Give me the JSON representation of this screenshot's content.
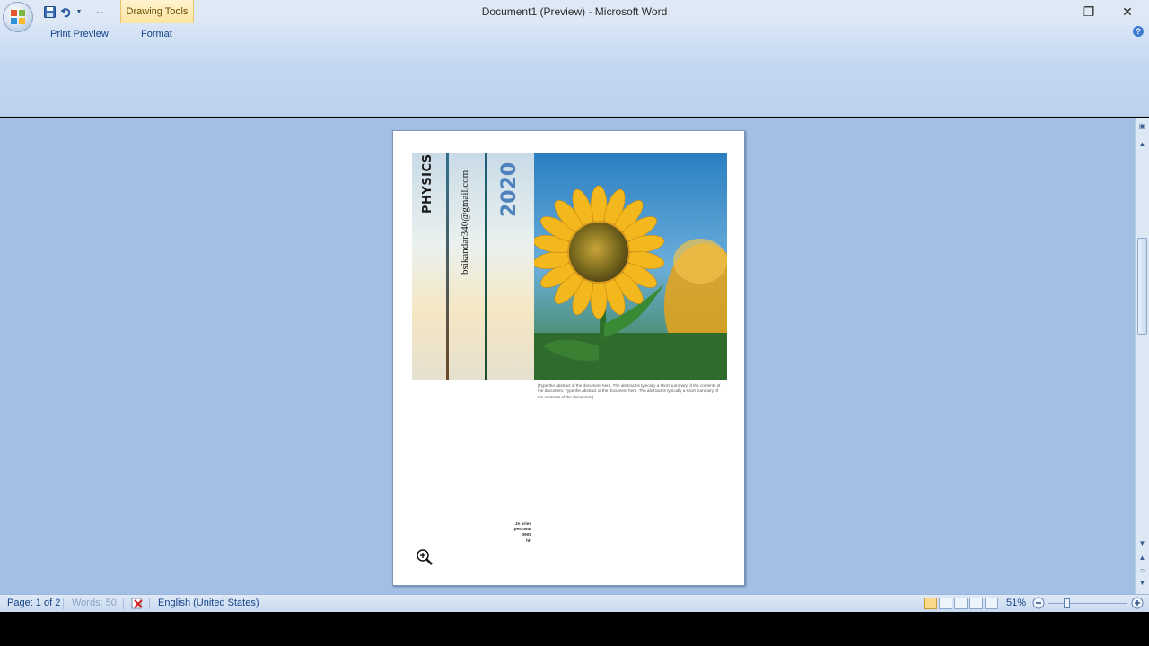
{
  "window": {
    "title": "Document1 (Preview) - Microsoft Word",
    "contextual_tab": "Drawing Tools",
    "controls": {
      "minimize": "—",
      "restore": "❐",
      "close": "✕"
    }
  },
  "quick_access": {
    "overflow": "··"
  },
  "ribbon": {
    "tabs": [
      "Print Preview",
      "Format"
    ],
    "help": "?"
  },
  "document": {
    "cover": {
      "subject": "PHYSICS",
      "email": "bsikandar340@gmail.com",
      "year": "2020",
      "abstract": "[Type the abstract of the document here. The abstract is typically a short summary of the contents of the document. Type the abstract of the document here. The abstract is typically a short summary of the contents of the document.]",
      "address_lines": [
        "Jn aries",
        "peshwar",
        "0908",
        "hh"
      ]
    }
  },
  "statusbar": {
    "page": "Page: 1 of 2",
    "words": "Words: 50",
    "language": "English (United States)",
    "zoom": "51%",
    "zoom_percent": 51
  },
  "colors": {
    "ribbon": "#c4d8f1",
    "workspace": "#a3bfe3",
    "year_text": "#4f81bd",
    "bar_blue": "#2f6f8f",
    "bar_brown": "#6b4a2a",
    "bar_green": "#1e4d2b"
  },
  "icons": [
    "office-logo-icon",
    "save-icon",
    "undo-icon",
    "dropdown-arrow-icon",
    "help-icon",
    "zoom-magnifier-icon",
    "proofing-error-icon",
    "zoom-out-icon",
    "zoom-in-icon"
  ]
}
